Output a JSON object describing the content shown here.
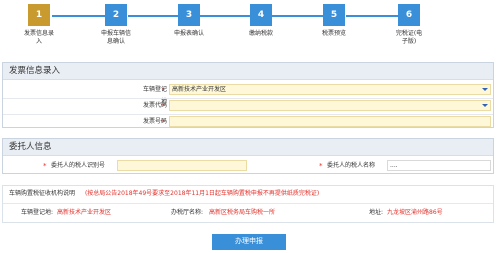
{
  "stepper": {
    "steps": [
      {
        "num": "1",
        "label": "发票信息录\n入"
      },
      {
        "num": "2",
        "label": "申报车辆信\n息确认"
      },
      {
        "num": "3",
        "label": "申报表确认"
      },
      {
        "num": "4",
        "label": "缴纳税款"
      },
      {
        "num": "5",
        "label": "税票预览"
      },
      {
        "num": "6",
        "label": "完税证(电\n子版)"
      }
    ]
  },
  "invoice_section": {
    "title": "发票信息录入",
    "reg_place_label": "车辆登记地",
    "reg_place_value": "高新技术产业开发区",
    "invoice_code_label": "发票代码",
    "invoice_code_value": "",
    "invoice_number_label": "发票号码",
    "invoice_number_value": ""
  },
  "agent_section": {
    "title": "委托人信息",
    "agent_id_label": "委托人的税人识别号",
    "agent_id_value": "",
    "agent_name_label": "委托人的税人名称",
    "agent_name_value": "....",
    "agent_name_placeholder": "...."
  },
  "notice_section": {
    "title": "车辆购置税征收机构说明",
    "notice": "(按总局公告2018年49号要求至2018年11月1日起车辆购置税申报不再提供纸质完税证)",
    "reg_place_label": "车辆登记地:",
    "reg_place_value": "高新技术产业开发区",
    "office_label": "办税厅名称:",
    "office_value": "高新区税务局车购税一所",
    "address_label": "地址:",
    "address_value": "九龙坡区渝州路86号"
  },
  "submit_label": "办理申报",
  "colors": {
    "accent_blue": "#3a8fd9",
    "active_step": "#c99a2e",
    "required_red": "#e0312b",
    "input_yellow": "#fff8d8"
  }
}
